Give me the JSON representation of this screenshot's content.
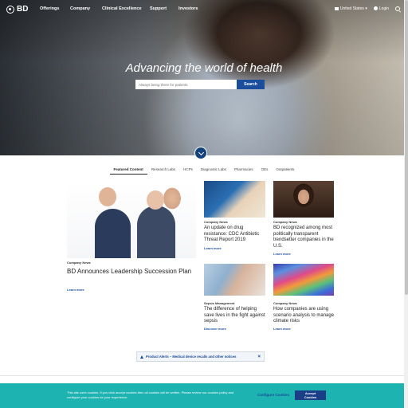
{
  "brand": {
    "logo_text": "BD"
  },
  "nav": {
    "items": [
      "Offerings",
      "Company",
      "Clinical Excellence",
      "Support",
      "Investors"
    ],
    "region": "United States",
    "login": "Login"
  },
  "hero": {
    "title": "Advancing the world of health",
    "search_placeholder": "Always being there for patients",
    "search_button": "Search"
  },
  "tabs": [
    "Featured Content",
    "Research Labs",
    "HCPs",
    "Diagnostic Labs",
    "Pharmacies",
    "OEs",
    "Outpatients"
  ],
  "active_tab": "Featured Content",
  "cards": {
    "big": {
      "category": "Company News",
      "title": "BD Announces Leadership Succession Plan",
      "link": "Learn more"
    },
    "c1": {
      "category": "Company News",
      "title": "An update on drug resistance: CDC Antibiotic Threat Report 2019",
      "link": "Learn more"
    },
    "c2": {
      "category": "Company News",
      "title": "BD recognized among most politically transparent trendsetter companies in the U.S.",
      "link": "Learn more"
    },
    "c3": {
      "category": "Sepsis Management",
      "title": "The difference of helping save lives in the fight against sepsis",
      "link": "Discover more"
    },
    "c4": {
      "category": "Company News",
      "title": "How companies are using scenario analysis to manage climate risks",
      "link": "Learn more"
    }
  },
  "alert": {
    "text": "Product Alerts – Medical device recalls and other notices",
    "close": "×"
  },
  "cookie": {
    "text": "This site uses cookies. If you click accept cookies then all cookies will be written. Please review our cookies policy and configure your cookies for your experience.",
    "settings": "Configure Cookies",
    "accept": "Accept Cookies"
  },
  "colors": {
    "brand_blue": "#1a4d9c",
    "cookie_teal": "#1cb3b0"
  }
}
